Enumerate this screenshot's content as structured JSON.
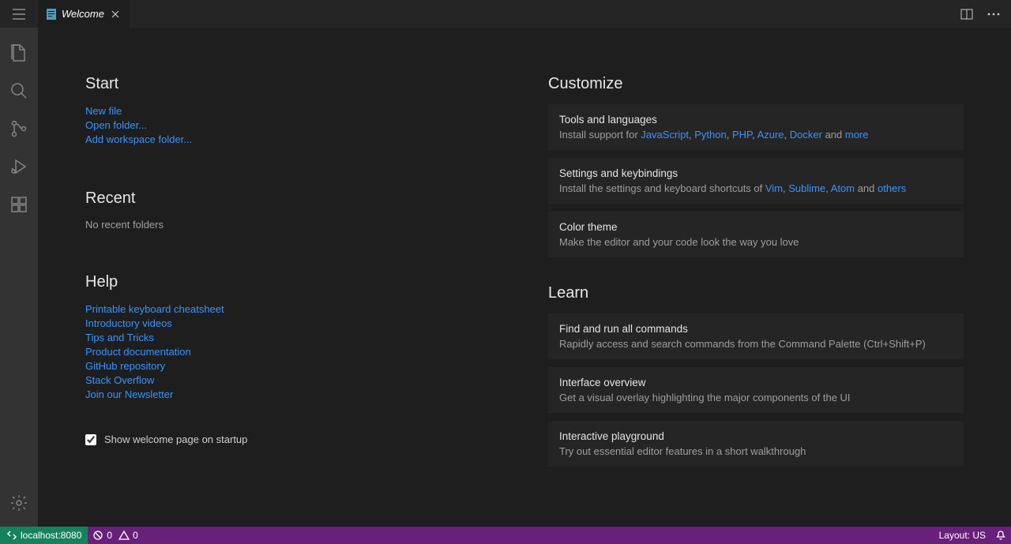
{
  "tab": {
    "title": "Welcome"
  },
  "start": {
    "heading": "Start",
    "links": {
      "new_file": "New file",
      "open_folder": "Open folder...",
      "add_workspace": "Add workspace folder..."
    }
  },
  "recent": {
    "heading": "Recent",
    "empty": "No recent folders"
  },
  "help": {
    "heading": "Help",
    "links": {
      "cheatsheet": "Printable keyboard cheatsheet",
      "videos": "Introductory videos",
      "tips": "Tips and Tricks",
      "docs": "Product documentation",
      "repo": "GitHub repository",
      "so": "Stack Overflow",
      "newsletter": "Join our Newsletter"
    }
  },
  "welcome_checkbox_label": "Show welcome page on startup",
  "customize": {
    "heading": "Customize",
    "tools": {
      "title": "Tools and languages",
      "desc_prefix": "Install support for ",
      "links": {
        "js": "JavaScript",
        "py": "Python",
        "php": "PHP",
        "azure": "Azure",
        "docker": "Docker",
        "more": "more"
      },
      "and": " and "
    },
    "keys": {
      "title": "Settings and keybindings",
      "desc_prefix": "Install the settings and keyboard shortcuts of ",
      "links": {
        "vim": "Vim",
        "sublime": "Sublime",
        "atom": "Atom",
        "others": "others"
      },
      "and": " and "
    },
    "theme": {
      "title": "Color theme",
      "desc": "Make the editor and your code look the way you love"
    }
  },
  "learn": {
    "heading": "Learn",
    "cmds": {
      "title": "Find and run all commands",
      "desc": "Rapidly access and search commands from the Command Palette (Ctrl+Shift+P)"
    },
    "ui": {
      "title": "Interface overview",
      "desc": "Get a visual overlay highlighting the major components of the UI"
    },
    "play": {
      "title": "Interactive playground",
      "desc": "Try out essential editor features in a short walkthrough"
    }
  },
  "status": {
    "remote": "localhost:8080",
    "errors": "0",
    "warnings": "0",
    "layout": "Layout: US"
  }
}
